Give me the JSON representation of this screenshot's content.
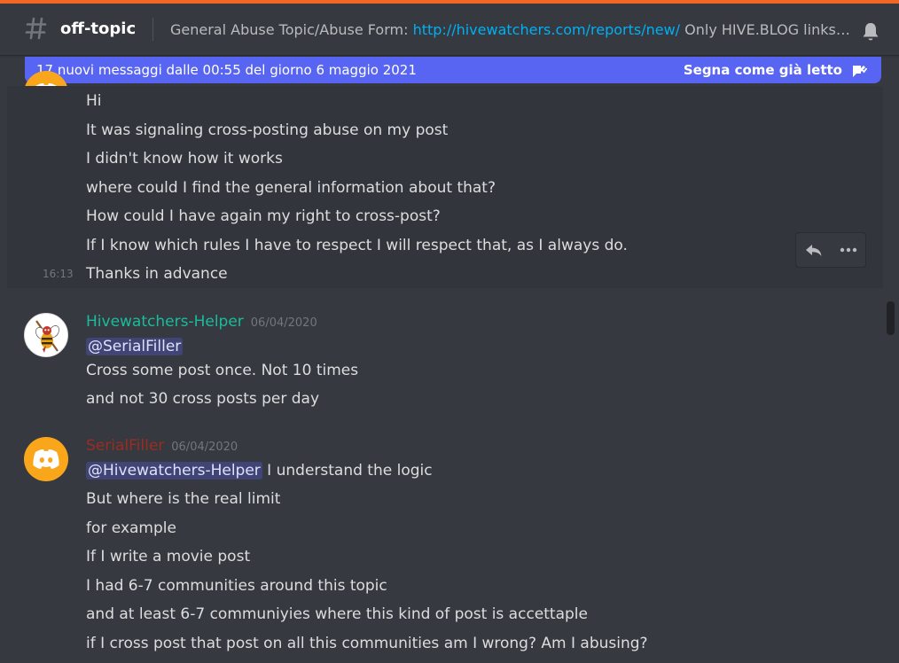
{
  "header": {
    "channel_icon": "hash-icon",
    "channel_name": "off-topic",
    "topic_prefix": "General Abuse Topic/Abuse Form: ",
    "topic_link": "http://hivewatchers.com/reports/new/",
    "topic_suffix": " Only HIVE.BLOG links(no...",
    "bell_icon": "bell-icon"
  },
  "new_messages_bar": {
    "text": "17 nuovi messaggi dalle 00:55 del giorno 6 maggio 2021",
    "mark_read": "Segna come già letto",
    "icon": "mark-read-icon"
  },
  "colors": {
    "accent": "#5865f2",
    "helper_name": "#1abc9c",
    "serialfiller_name": "#992d22",
    "link": "#00b0f4",
    "top_line": "#f26522",
    "discord_avatar": "#faa61a"
  },
  "messages": [
    {
      "continuation_lines": [
        "Hi",
        "It was signaling cross-posting abuse on my post",
        "I didn't know how it works",
        "where could I find the general information about that?",
        "How could I have again my right to cross-post?",
        "If I know which rules I have to respect I will respect that, as I always do.",
        "Thanks in advance"
      ],
      "hover_timestamp": "16:13"
    },
    {
      "author": "Hivewatchers-Helper",
      "date": "06/04/2020",
      "mention": "@SerialFiller",
      "lines": [
        "Cross some post once. Not 10 times",
        "and not 30 cross posts per day"
      ]
    },
    {
      "author": "SerialFiller",
      "date": "06/04/2020",
      "mention": "@Hivewatchers-Helper",
      "first_line_rest": " I understand the logic",
      "lines": [
        "But where is the real limit",
        "for example",
        "If I write a movie post",
        "I had 6-7 communities around this topic",
        "and at least 6-7 communiyies where this kind of post is accettaple",
        "if I cross post that post on all this communities am I wrong? Am I abusing?"
      ]
    }
  ],
  "message_tools": {
    "reply_icon": "reply-icon",
    "more_icon": "more-options-icon"
  }
}
